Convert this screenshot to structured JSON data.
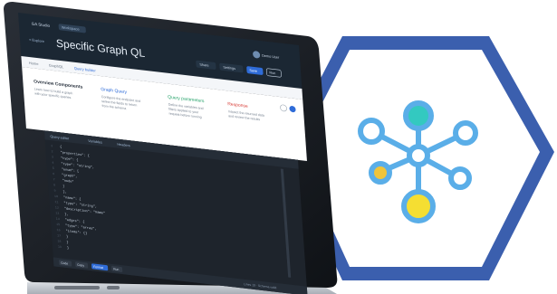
{
  "app": {
    "brand": "GA Studio",
    "workspace": "Workspace",
    "title": "Specific Graph QL",
    "nav_back": "< Explore",
    "header_buttons": [
      "Share",
      "Settings",
      "Save",
      "Run"
    ],
    "user": "Demo User"
  },
  "breadcrumb": {
    "items": [
      "Home",
      "GraphQL",
      "Query builder"
    ]
  },
  "cards": [
    {
      "title": "Overview Components",
      "lines": [
        "Learn how to build a graph",
        "with your specific queries"
      ]
    },
    {
      "title": "Graph Query",
      "lines": [
        "Configure the endpoint and",
        "select the fields to return",
        "from the schema"
      ]
    },
    {
      "title": "Query parameters",
      "lines": [
        "Define the variables and",
        "filters applied to your",
        "request before running"
      ]
    },
    {
      "title": "Response",
      "lines": [
        "Inspect the returned data",
        "and review the results"
      ]
    }
  ],
  "editor": {
    "tabs": [
      "Query editor",
      "Variables",
      "Headers"
    ],
    "lines": [
      "{",
      "  \"properties\": {",
      "    \"type\": {",
      "      \"type\": \"string\",",
      "      \"enum\": [",
      "        \"graph\",",
      "        \"node\"",
      "      ]",
      "    },",
      "    \"name\": {",
      "      \"type\": \"string\",",
      "      \"description\": \"Name\"",
      "    },",
      "    \"edges\": {",
      "      \"type\": \"array\",",
      "      \"items\": {}",
      "    }",
      "  }",
      "}"
    ],
    "footer_buttons": [
      "Code",
      "Copy",
      "Format",
      "Run"
    ],
    "status": "Lines 19 · Schema valid"
  },
  "colors": {
    "hex_outline": "#3b5fae",
    "hex_fill": "#ffffff",
    "node_blue": "#5aaee8",
    "node_teal": "#33c9c0",
    "node_yellow": "#f5de32",
    "node_gold": "#efc43a",
    "accent": "#2f6cd8",
    "editor_bg": "#1e242c"
  },
  "icons": {
    "graph": "network-graph-icon",
    "user": "avatar-icon",
    "laptop": "laptop-icon"
  }
}
